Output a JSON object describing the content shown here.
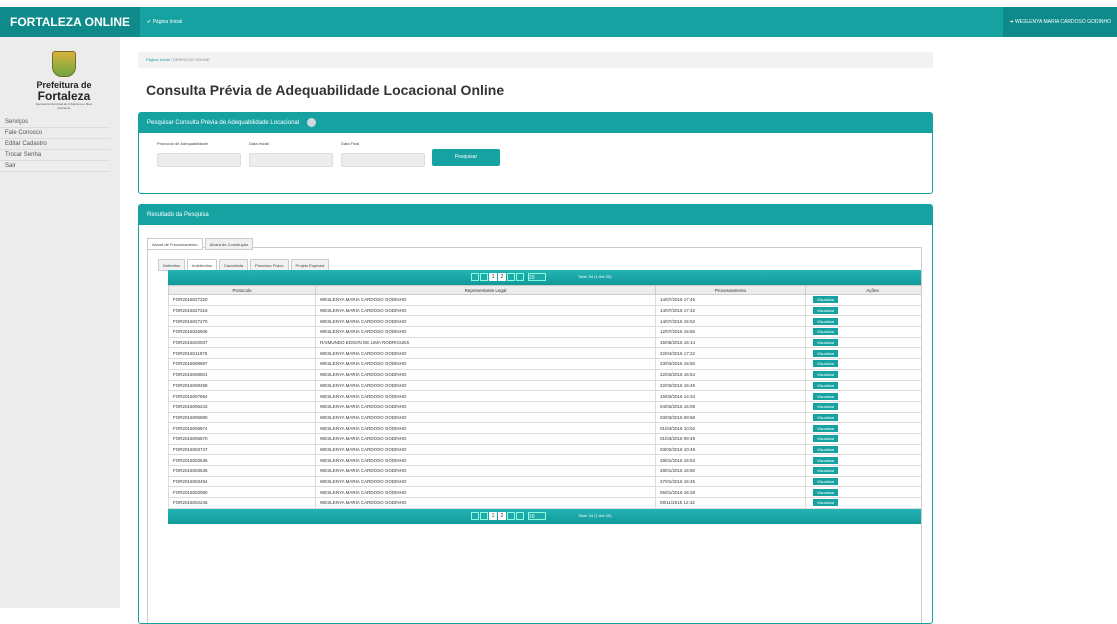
{
  "topbar": {
    "brand": "FORTALEZA ONLINE",
    "home": "✔ Página Inicial",
    "user": "➜ WESLENYA MARIA CARDOSO GODINHO"
  },
  "logo": {
    "line1": "Prefeitura de",
    "line2": "Fortaleza",
    "line3": "Secretaria Municipal de Urbanismo e Meio Ambiente"
  },
  "menu": [
    "Serviços",
    "Fale Conosco",
    "Editar Cadastro",
    "Trocar Senha",
    "Sair"
  ],
  "breadcrumb": {
    "home": "Página Inicial",
    "current": "SERVIÇOS ONLINE"
  },
  "page_title": "Consulta Prévia de Adequabilidade Locacional Online",
  "search": {
    "title": "Pesquisar Consulta Prévia de Adequabilidade Locacional",
    "protocol_label": "Protocolo de Adequabilidade",
    "date_start_label": "Data Inicial",
    "date_end_label": "Data Final",
    "button": "Pesquisar"
  },
  "results": {
    "title": "Resultado da Pesquisa",
    "tabs": [
      "Alvará de Funcionamento",
      "Alvará de Construção"
    ],
    "subtabs": [
      "Deferidos",
      "Indeferidos",
      "Cancelada",
      "Processo Físico",
      "Projeto Especial"
    ],
    "pager": {
      "pages": [
        "1",
        "2"
      ],
      "per_page": "20",
      "total": "Total: 34 (1 Até 20)"
    },
    "columns": [
      "Protocolo",
      "Representante Legal",
      "Processamento",
      "Ações"
    ],
    "action_label": "Visualizar",
    "rows": [
      [
        "FOR2016027320",
        "WESLENYA MARIA CARDOSO GODINHO",
        "14/07/2016 17:45"
      ],
      [
        "FOR2016027318",
        "WESLENYA MARIA CARDOSO GODINHO",
        "14/07/2016 17:42"
      ],
      [
        "FOR2016027270",
        "WESLENYA MARIA CARDOSO GODINHO",
        "14/07/2016 15:52"
      ],
      [
        "FOR2016026606",
        "WESLENYA MARIA CARDOSO GODINHO",
        "12/07/2016 15:56"
      ],
      [
        "FOR2016020037",
        "RAIMUNDO EDSON DE LIMA RODRIGUES",
        "15/06/2016 15:14"
      ],
      [
        "FOR2016011875",
        "WESLENYA MARIA CARDOSO GODINHO",
        "22/04/2016 17:22"
      ],
      [
        "FOR2016008687",
        "WESLENYA MARIA CARDOSO GODINHO",
        "23/03/2016 15:50"
      ],
      [
        "FOR2016008501",
        "WESLENYA MARIA CARDOSO GODINHO",
        "22/03/2016 16:54"
      ],
      [
        "FOR2016008498",
        "WESLENYA MARIA CARDOSO GODINHO",
        "22/03/2016 16:49"
      ],
      [
        "FOR2016007694",
        "WESLENYA MARIA CARDOSO GODINHO",
        "16/03/2016 14:34"
      ],
      [
        "FOR2016006243",
        "WESLENYA MARIA CARDOSO GODINHO",
        "04/03/2016 15:08"
      ],
      [
        "FOR2016005980",
        "WESLENYA MARIA CARDOSO GODINHO",
        "03/03/2016 09:58"
      ],
      [
        "FOR2016005674",
        "WESLENYA MARIA CARDOSO GODINHO",
        "01/03/2016 10:02"
      ],
      [
        "FOR2016005670",
        "WESLENYA MARIA CARDOSO GODINHO",
        "01/03/2016 09:49"
      ],
      [
        "FOR2016003747",
        "WESLENYA MARIA CARDOSO GODINHO",
        "03/02/2016 10:48"
      ],
      [
        "FOR2016003536",
        "WESLENYA MARIA CARDOSO GODINHO",
        "28/01/2016 15:53"
      ],
      [
        "FOR2016003535",
        "WESLENYA MARIA CARDOSO GODINHO",
        "28/01/2016 15:50"
      ],
      [
        "FOR2016003494",
        "WESLENYA MARIA CARDOSO GODINHO",
        "27/01/2016 16:45"
      ],
      [
        "FOR2016003080",
        "WESLENYA MARIA CARDOSO GODINHO",
        "06/01/2016 16:28"
      ],
      [
        "FOR2015002245",
        "WESLENYA MARIA CARDOSO GODINHO",
        "09/11/2015 12:42"
      ]
    ]
  }
}
